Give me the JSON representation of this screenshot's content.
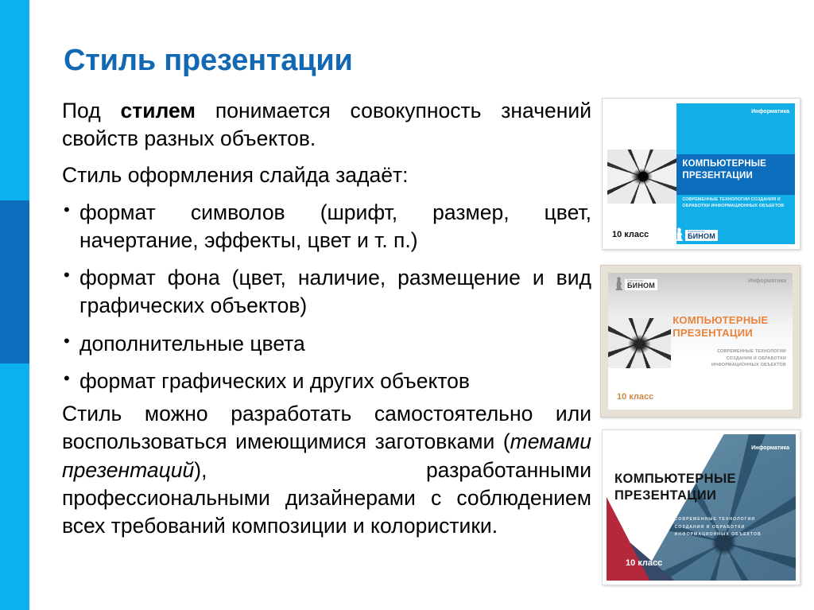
{
  "slide": {
    "title": "Стиль презентации"
  },
  "colors": {
    "stripe_light": "#0CB0EE",
    "stripe_dark": "#0C6DBD",
    "title_blue": "#1268B3",
    "body_text": "#000000"
  },
  "left_stripe": {
    "segment_top": "light-blue",
    "segment_middle": "dark-blue",
    "segment_bottom": "light-blue"
  },
  "body": {
    "paragraph_1_prefix": "Под ",
    "paragraph_1_bold": "стилем",
    "paragraph_1_suffix": " понимается совокупность значений свойств разных объектов.",
    "paragraph_2": "Стиль оформления слайда задаёт:",
    "bullets": [
      {
        "marker": "•",
        "text": "формат символов (шрифт, размер, цвет, начертание, эффекты, цвет и т. п.)"
      },
      {
        "marker": "•",
        "text": "формат фона (цвет, наличие, размещение и вид графических объектов)"
      },
      {
        "marker": "•",
        "text": "дополнительные цвета"
      },
      {
        "marker": "•",
        "text": "формат графических и других объектов"
      }
    ],
    "paragraph_3_part1": "Стиль можно разработать самостоятельно или воспользоваться имеющимися заготовками (",
    "paragraph_3_italic": "темами презентаций",
    "paragraph_3_part2": "), разработанными профессиональными дизайнерами с соблюдением всех требований композиции и колористики."
  },
  "thumbnails": [
    {
      "name": "blue-cover",
      "subject": "Информатика",
      "title_line_1": "КОМПЬЮТЕРНЫЕ",
      "title_line_2": "ПРЕЗЕНТАЦИИ",
      "subtitle_line_1": "СОВРЕМЕННЫЕ  ТЕХНОЛОГИИ СОЗДАНИЯ И",
      "subtitle_line_2": "ОБРАБОТКИ ИНФОРМАЦИОННЫХ ОБЪЕКТОВ",
      "grade": "10 класс",
      "publisher_sup": "Издательство",
      "publisher_name": "БИНОМ"
    },
    {
      "name": "grey-orange-cover",
      "subject": "Информатика",
      "title_line_1": "КОМПЬЮТЕРНЫЕ",
      "title_line_2": "ПРЕЗЕНТАЦИИ",
      "subtitle_line_1": "СОВРЕМЕННЫЕ  ТЕХНОЛОГИИ",
      "subtitle_line_2": "СОЗДАНИЯ И ОБРАБОТКИ",
      "subtitle_line_3": "ИНФОРМАЦИОННЫХ ОБЪЕКТОВ",
      "grade": "10 класс",
      "publisher_sup": "Издательство",
      "publisher_name": "БИНОМ"
    },
    {
      "name": "navy-red-cover",
      "subject": "Информатика",
      "title_line_1": "КОМПЬЮТЕРНЫЕ",
      "title_line_2": "ПРЕЗЕНТАЦИИ",
      "subtitle_line_1": "СОВРЕМЕННЫЕ  ТЕХНОЛОГИИ",
      "subtitle_line_2": "СОЗДАНИЯ  И  ОБРАБОТКИ",
      "subtitle_line_3": "ИНФОРМАЦИОННЫХ ОБЪЕКТОВ",
      "grade": "10 класс"
    }
  ]
}
